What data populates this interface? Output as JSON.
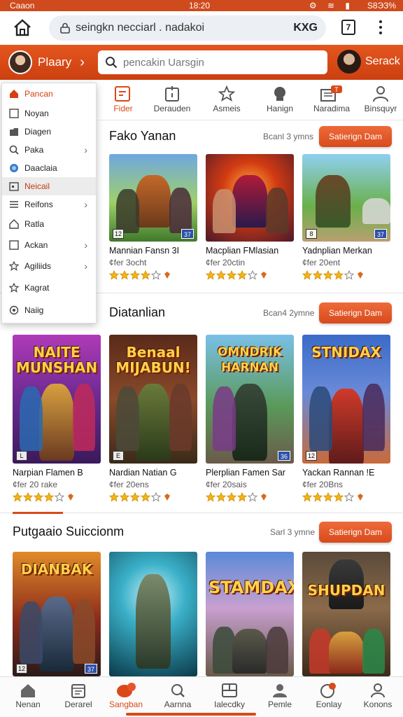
{
  "status_bar": {
    "carrier": "Caaon",
    "time": "18:20",
    "battery": "S8ЭЗ%"
  },
  "browser": {
    "url": "seingkn necciarl . nadakoi",
    "url_right": "KXG",
    "tabs_count": "7"
  },
  "header": {
    "profile_name": "Plaary",
    "search_placeholder": "pencakin Uarsgin",
    "right_label": "Serack",
    "colors": {
      "accent": "#d94a18",
      "header": "#e4561e"
    }
  },
  "categories": [
    {
      "label": "Fider",
      "icon": "tag-icon",
      "active": true
    },
    {
      "label": "Derauden",
      "icon": "badge-icon"
    },
    {
      "label": "Asmeis",
      "icon": "star-outline-icon"
    },
    {
      "label": "Hanign",
      "icon": "controller-icon"
    },
    {
      "label": "Naradima",
      "icon": "news-icon",
      "badge": "T"
    },
    {
      "label": "Binsquyr",
      "icon": "person-icon"
    }
  ],
  "dropdown": [
    {
      "label": "Pancan",
      "icon": "home-icon"
    },
    {
      "label": "Noyan",
      "icon": "square-icon"
    },
    {
      "label": "Diagen",
      "icon": "folder-icon"
    },
    {
      "label": "Paka",
      "icon": "search-icon",
      "submenu": true
    },
    {
      "label": "Daaclaia",
      "icon": "globe-icon"
    },
    {
      "label": "Neicail",
      "icon": "calendar-icon",
      "selected": true
    },
    {
      "label": "Reifons",
      "icon": "list-icon",
      "submenu": true
    },
    {
      "label": "Ratla",
      "icon": "house-outline-icon"
    },
    {
      "label": "Ackan",
      "icon": "square-icon",
      "submenu": true
    },
    {
      "label": "Agiliids",
      "icon": "star-outline-icon",
      "submenu": true
    },
    {
      "label": "Kagrat",
      "icon": "star-outline-icon"
    },
    {
      "label": "Naiig",
      "icon": "settings-icon"
    }
  ],
  "sections": [
    {
      "title": "Fako Yanan",
      "meta": "Bcanl 3 ymns",
      "button": "Satierign Dam",
      "games": [
        {
          "name": "Mannian Fansn 3I",
          "sub": "¢fer 3ocht",
          "rating": 4,
          "badge_l": "12",
          "badge_r": "37"
        },
        {
          "name": "Macplian FMlasian",
          "sub": "¢fer 20ctin",
          "rating": 4,
          "badge_l": "",
          "badge_r": ""
        },
        {
          "name": "Yadnplian Merkan",
          "sub": "¢fer 20ent",
          "rating": 4,
          "badge_l": "8",
          "badge_r": "37"
        }
      ]
    },
    {
      "title": "Diatanlian",
      "meta": "Bcan4 2ymne",
      "button": "Satierign Dam",
      "games": [
        {
          "cover_title": "NAITE MUNSHAN",
          "name": "Narpian Flamen B",
          "sub": "¢fer 20 rake",
          "rating": 4,
          "badge_l": "L",
          "badge_r": ""
        },
        {
          "cover_title": "Benaal MIJABUN!",
          "name": "Nardian Natian G",
          "sub": "¢fer 20ens",
          "rating": 4,
          "badge_l": "E",
          "badge_r": ""
        },
        {
          "cover_title": "OMNDRIK HARNAN",
          "name": "Plerplian Famen Sar",
          "sub": "¢fer 20sais",
          "rating": 4,
          "badge_l": "",
          "badge_r": "36"
        },
        {
          "cover_title": "STNIDAX",
          "name": "Yackan Rannan !E",
          "sub": "¢fer 20Bns",
          "rating": 4,
          "badge_l": "12",
          "badge_r": ""
        }
      ]
    },
    {
      "title": "Putgaaio Suiccionm",
      "meta": "Sarl 3 ymne",
      "button": "Satierign Dam",
      "games": [
        {
          "cover_title": "DIANBAK",
          "badge_l": "12",
          "badge_r": "37"
        },
        {
          "cover_title": "",
          "badge_l": "",
          "badge_r": ""
        },
        {
          "cover_title": "STAMDAX",
          "badge_l": "",
          "badge_r": ""
        },
        {
          "cover_title": "SHUPDAN",
          "badge_l": "",
          "badge_r": ""
        }
      ]
    }
  ],
  "bottom_nav": [
    {
      "label": "Nenan",
      "icon": "home-icon"
    },
    {
      "label": "Derarel",
      "icon": "calendar-icon"
    },
    {
      "label": "Sangban",
      "icon": "chat-icon",
      "active": true
    },
    {
      "label": "Aarnna",
      "icon": "search-icon"
    },
    {
      "label": "Ialecdky",
      "icon": "grid-icon"
    },
    {
      "label": "Pemle",
      "icon": "person-icon"
    },
    {
      "label": "Eonlay",
      "icon": "bell-icon"
    },
    {
      "label": "Konons",
      "icon": "user-icon"
    }
  ]
}
